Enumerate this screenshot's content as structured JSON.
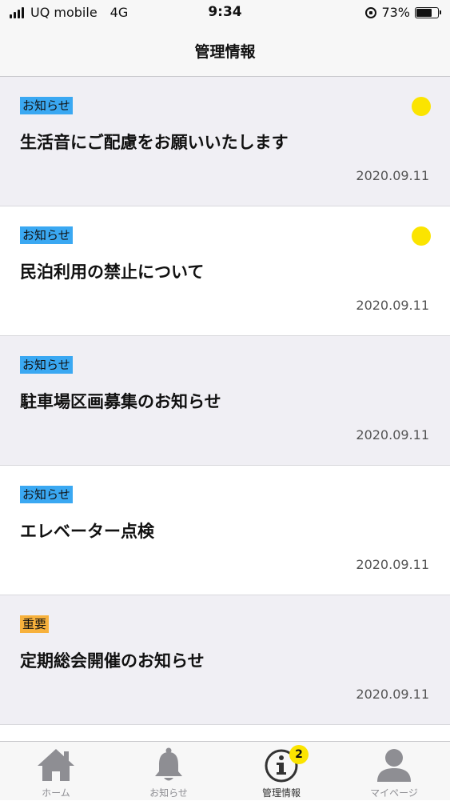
{
  "status_bar": {
    "carrier": "UQ mobile",
    "network": "4G",
    "time": "9:34",
    "battery": "73%",
    "battery_level": 0.73
  },
  "nav": {
    "title": "管理情報"
  },
  "items": [
    {
      "tag": "お知らせ",
      "tag_type": "notice",
      "title": "生活音にご配慮をお願いいたします",
      "date": "2020.09.11",
      "unread": true
    },
    {
      "tag": "お知らせ",
      "tag_type": "notice",
      "title": "民泊利用の禁止について",
      "date": "2020.09.11",
      "unread": true
    },
    {
      "tag": "お知らせ",
      "tag_type": "notice",
      "title": "駐車場区画募集のお知らせ",
      "date": "2020.09.11",
      "unread": false
    },
    {
      "tag": "お知らせ",
      "tag_type": "notice",
      "title": "エレベーター点検",
      "date": "2020.09.11",
      "unread": false
    },
    {
      "tag": "重要",
      "tag_type": "important",
      "title": "定期総会開催のお知らせ",
      "date": "2020.09.11",
      "unread": false
    }
  ],
  "tabs": [
    {
      "label": "ホーム",
      "icon": "home-icon"
    },
    {
      "label": "お知らせ",
      "icon": "bell-icon"
    },
    {
      "label": "管理情報",
      "icon": "info-icon",
      "badge": "2",
      "active": true
    },
    {
      "label": "マイページ",
      "icon": "person-icon"
    }
  ],
  "colors": {
    "notice_tag": "#3aa8f2",
    "important_tag": "#f7b13c",
    "unread_dot": "#fbe400",
    "badge": "#fbe400"
  }
}
